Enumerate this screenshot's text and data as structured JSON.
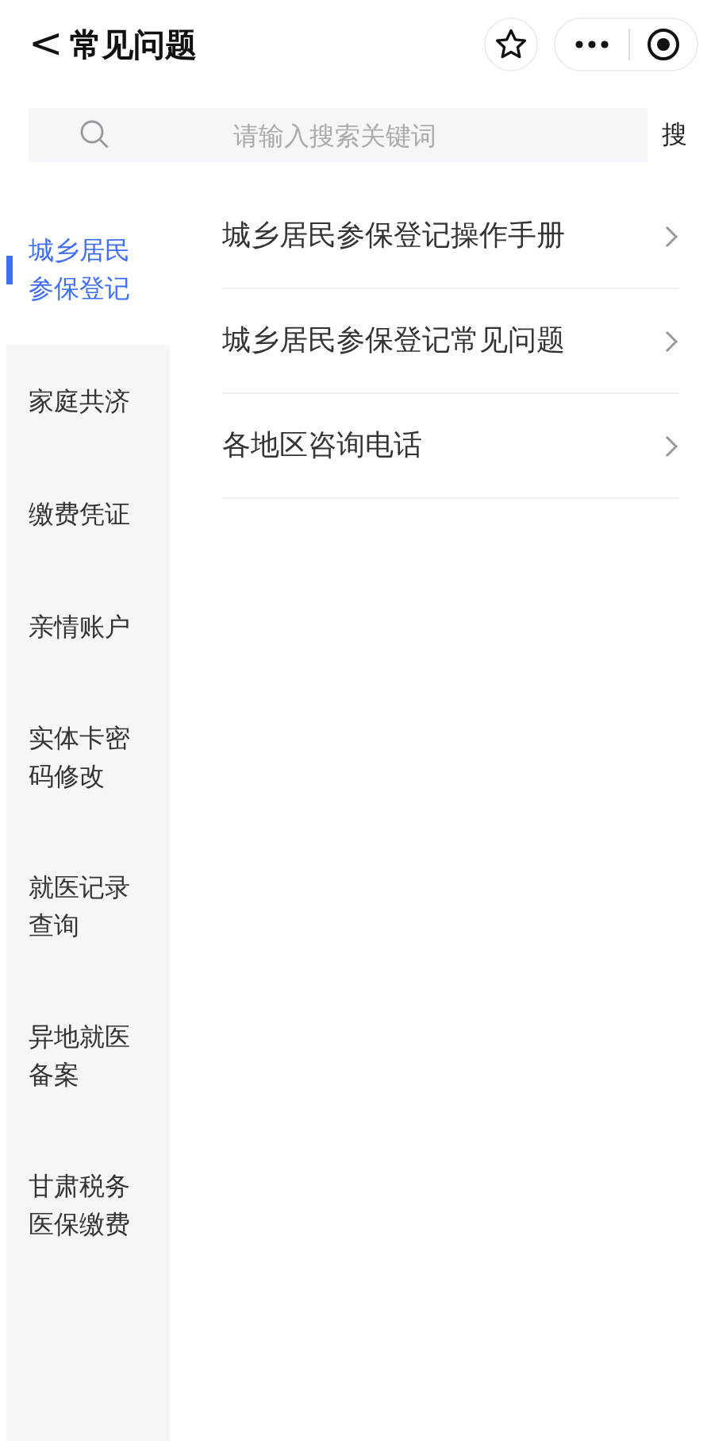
{
  "header": {
    "back": "<",
    "title": "常见问题"
  },
  "search": {
    "placeholder": "请输入搜索关键词",
    "button": "搜"
  },
  "sidebar": {
    "items": [
      {
        "label": "城乡居民参保登记",
        "selected": true
      },
      {
        "label": "家庭共济",
        "selected": false
      },
      {
        "label": "缴费凭证",
        "selected": false
      },
      {
        "label": "亲情账户",
        "selected": false
      },
      {
        "label": "实体卡密码修改",
        "selected": false
      },
      {
        "label": "就医记录查询",
        "selected": false
      },
      {
        "label": "异地就医备案",
        "selected": false
      },
      {
        "label": "甘肃税务医保缴费",
        "selected": false
      }
    ]
  },
  "list": {
    "items": [
      {
        "label": "城乡居民参保登记操作手册"
      },
      {
        "label": "城乡居民参保登记常见问题"
      },
      {
        "label": "各地区咨询电话"
      }
    ]
  }
}
